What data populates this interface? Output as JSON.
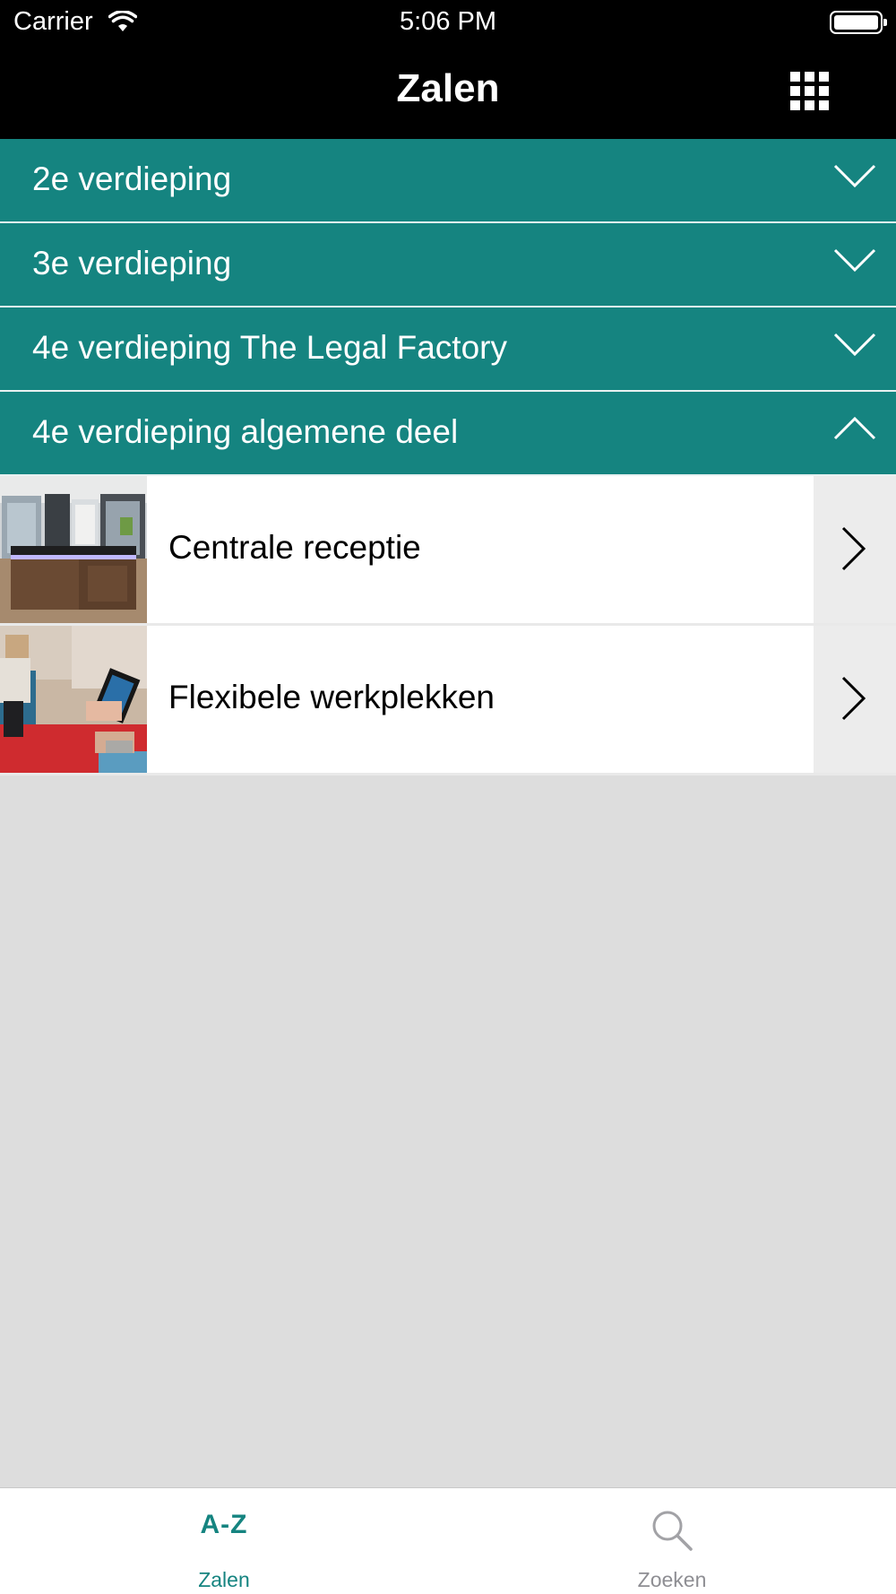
{
  "status_bar": {
    "carrier": "Carrier",
    "time": "5:06 PM"
  },
  "nav": {
    "title": "Zalen",
    "menu_icon": "grid-icon"
  },
  "colors": {
    "accent": "#158480",
    "background": "#dddddd",
    "nav_background": "#000000"
  },
  "sections": [
    {
      "label": "2e verdieping",
      "expanded": false
    },
    {
      "label": "3e verdieping",
      "expanded": false
    },
    {
      "label": "4e verdieping The Legal Factory",
      "expanded": false
    },
    {
      "label": "4e verdieping algemene deel",
      "expanded": true
    }
  ],
  "rooms": [
    {
      "label": "Centrale receptie",
      "icon": "chevron-right-icon"
    },
    {
      "label": "Flexibele werkplekken",
      "icon": "chevron-right-icon"
    }
  ],
  "tabs": [
    {
      "icon_text": "A-Z",
      "label": "Zalen",
      "active": true
    },
    {
      "icon": "search-icon",
      "label": "Zoeken",
      "active": false
    }
  ]
}
